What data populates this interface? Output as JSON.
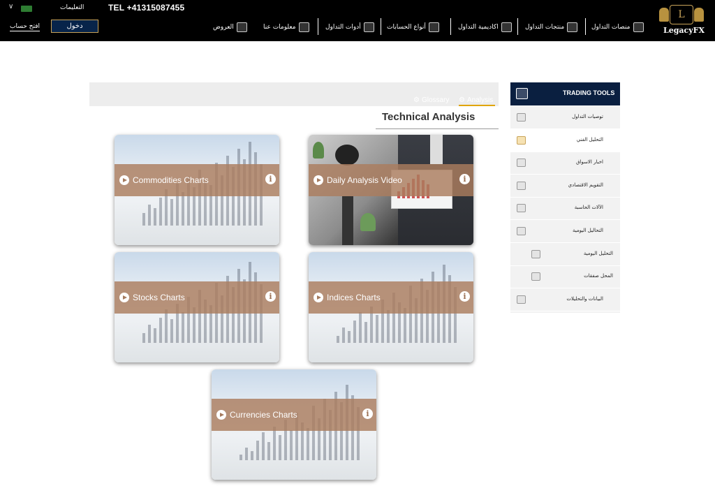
{
  "header": {
    "language_label": "التعليمات",
    "tel": "TEL +41315087455",
    "open_account": "افتح حساب",
    "login": "دخول",
    "logo_text": "LegacyFX",
    "logo_mark": "L",
    "nav": [
      {
        "label": "منصات التداول",
        "icon": "platform-icon"
      },
      {
        "label": "منتجات التداول",
        "icon": "products-icon"
      },
      {
        "label": "اكاديمية التداول",
        "icon": "academy-icon"
      },
      {
        "label": "أنواع الحسابات",
        "icon": "accounts-icon"
      },
      {
        "label": "أدوات التداول",
        "icon": "tools-icon"
      },
      {
        "label": "معلومات عنا",
        "icon": "about-icon"
      },
      {
        "label": "العروض",
        "icon": "offers-icon"
      }
    ]
  },
  "tabs": [
    {
      "label": "Analysis",
      "icon": "gear-icon",
      "active": true
    },
    {
      "label": "Glossary",
      "icon": "gear-icon",
      "active": false
    }
  ],
  "section_title": "Technical Analysis",
  "cards": [
    {
      "label": "Commodities Charts"
    },
    {
      "label": "Daily Analysis Video"
    },
    {
      "label": "Stocks Charts"
    },
    {
      "label": "Indices Charts"
    },
    {
      "label": "Currencies Charts"
    }
  ],
  "sidebar": {
    "title": "TRADING TOOLS",
    "items": [
      {
        "label": "توصيات التداول",
        "active": false
      },
      {
        "label": "التحليل الفني",
        "active": true
      },
      {
        "label": "اخبار الاسواق",
        "active": false
      },
      {
        "label": "التقويم الاقتصادي",
        "active": false
      },
      {
        "label": "الآلات الحاسبة",
        "active": false
      },
      {
        "label": "التحاليل اليومية",
        "active": false
      },
      {
        "label": "التحليل اليومية",
        "active": false,
        "sub": true
      },
      {
        "label": "المحل صفقات",
        "active": false,
        "sub": true
      },
      {
        "label": "البيانات والتحليلات",
        "active": false
      }
    ]
  },
  "colors": {
    "header_bg": "#000000",
    "accent_gold": "#c9a45a",
    "card_band": "#ab7c5e",
    "sidebar_head": "#0a1f40",
    "tab_underline": "#e0a500"
  }
}
